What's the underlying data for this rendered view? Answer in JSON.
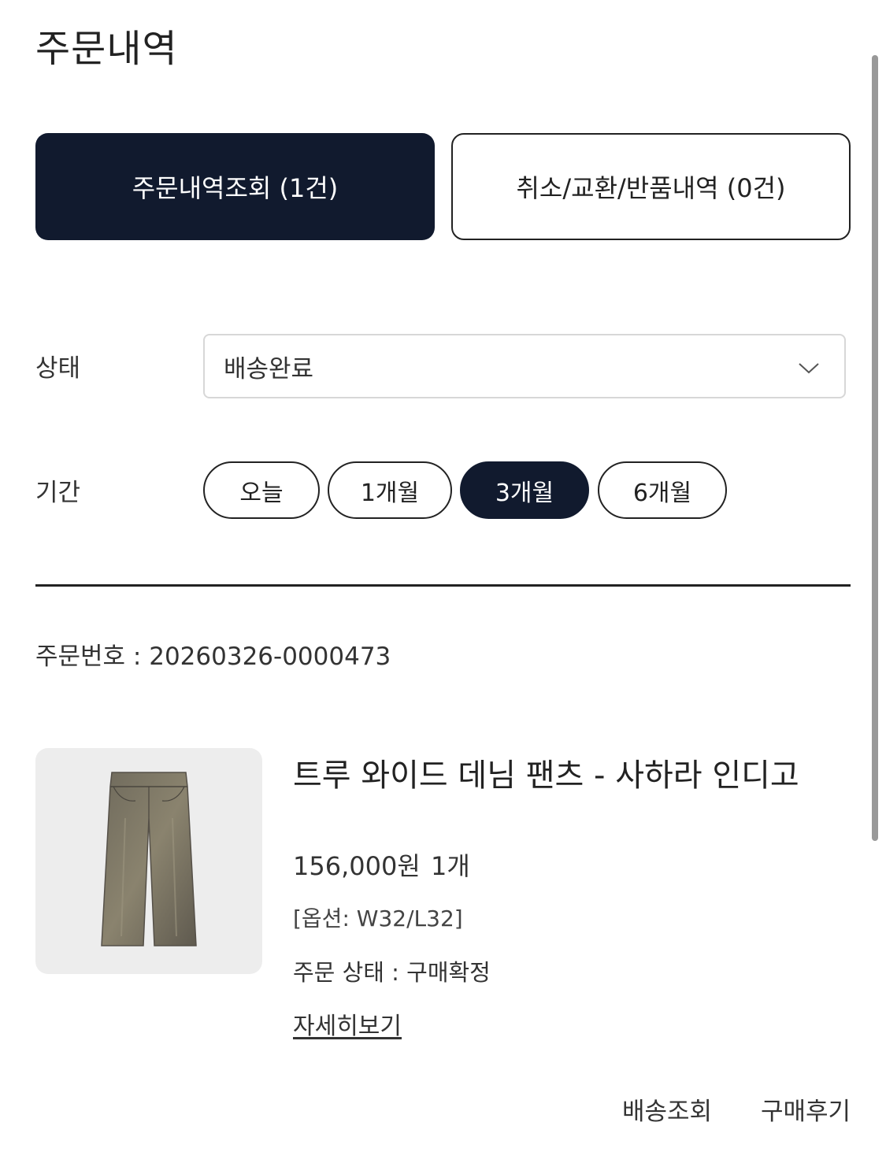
{
  "page": {
    "title": "주문내역"
  },
  "tabs": [
    {
      "label": "주문내역조회 (1건)",
      "active": true
    },
    {
      "label": "취소/교환/반품내역 (0건)",
      "active": false
    }
  ],
  "filters": {
    "status_label": "상태",
    "status_value": "배송완료",
    "period_label": "기간",
    "period_options": [
      {
        "label": "오늘",
        "active": false
      },
      {
        "label": "1개월",
        "active": false
      },
      {
        "label": "3개월",
        "active": true
      },
      {
        "label": "6개월",
        "active": false
      }
    ]
  },
  "order": {
    "number_text": "주문번호 : 20260326-0000473",
    "product": {
      "name": "트루 와이드 데님 팬츠 - 사하라 인디고",
      "price": "156,000원",
      "quantity": "1개",
      "option": "[옵션: W32/L32]",
      "status": "주문 상태 : 구매확정",
      "detail_link": "자세히보기",
      "image_icon": "jeans-image"
    },
    "actions": {
      "tracking": "배송조회",
      "review": "구매후기"
    }
  },
  "colors": {
    "accent_dark": "#111a2e",
    "thumb_bg": "#ededed"
  }
}
